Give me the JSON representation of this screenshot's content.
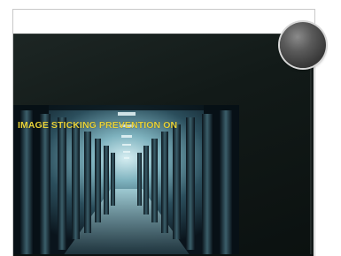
{
  "screen": {
    "overlay_message": "IMAGE STICKING PREVENTION ON"
  },
  "colors": {
    "bezel": "#121a18",
    "overlay_text": "#e8d33a",
    "knob": "#4a4a4a",
    "background": "#ffffff"
  },
  "icons": {
    "knob": "round-control-knob-icon"
  }
}
